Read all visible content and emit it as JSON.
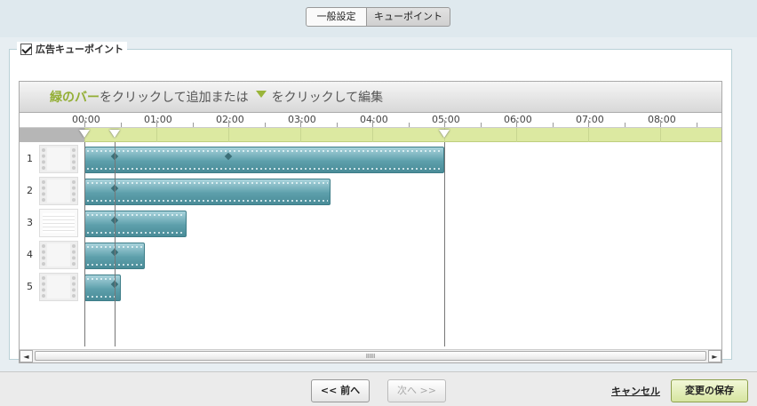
{
  "tabs": {
    "general": "一般設定",
    "cue_points": "キューポイント"
  },
  "section": {
    "legend": "広告キューポイント",
    "checked": true
  },
  "instructions": {
    "green_bar": "緑のバー",
    "part1": " をクリックして追加または",
    "part2": "をクリックして編集"
  },
  "ruler": {
    "labels": [
      "00:00",
      "01:00",
      "02:00",
      "03:00",
      "04:00",
      "05:00",
      "06:00",
      "07:00",
      "08:00"
    ]
  },
  "rows": [
    {
      "number": "1",
      "thumbnail": "video-thumbnail",
      "length": "05:00"
    },
    {
      "number": "2",
      "thumbnail": "video-thumbnail",
      "length": "03:25"
    },
    {
      "number": "3",
      "thumbnail": "document-thumbnail",
      "length": "01:25"
    },
    {
      "number": "4",
      "thumbnail": "video-thumbnail",
      "length": "00:50"
    },
    {
      "number": "5",
      "thumbnail": "video-thumbnail",
      "length": "00:30"
    }
  ],
  "cue_points": [
    "00:00",
    "00:25",
    "05:00"
  ],
  "scrollbar": {
    "left": "◄",
    "right": "►",
    "grip": "IIIII"
  },
  "footer": {
    "prev": "<< 前へ",
    "next": "次へ >>",
    "cancel": "キャンセル",
    "save": "変更の保存"
  },
  "colors": {
    "accent_green": "#93ae35",
    "clip_teal": "#5d9fab",
    "cue_bar": "#dce9a1"
  }
}
